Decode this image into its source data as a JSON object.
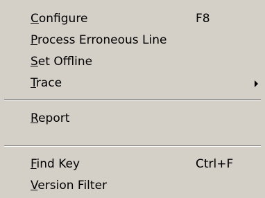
{
  "menu": {
    "items": [
      {
        "mnemonic": "C",
        "rest": "onfigure",
        "shortcut": "F8"
      },
      {
        "mnemonic": "P",
        "rest": "rocess Erroneous Line",
        "shortcut": ""
      },
      {
        "mnemonic": "S",
        "rest": "et Offline",
        "shortcut": ""
      },
      {
        "mnemonic": "T",
        "rest": "race",
        "shortcut": "",
        "submenu_icon": "triangle-right-icon"
      },
      {
        "mnemonic": "R",
        "rest": "eport",
        "shortcut": ""
      },
      {
        "mnemonic": "F",
        "rest": "ind Key",
        "shortcut": "Ctrl+F"
      },
      {
        "mnemonic": "V",
        "rest": "ersion Filter",
        "shortcut": ""
      }
    ]
  },
  "colors": {
    "menu_background": "#d4d0c8",
    "text": "#000000",
    "separator_shadow": "#808080",
    "separator_highlight": "#ffffff"
  }
}
